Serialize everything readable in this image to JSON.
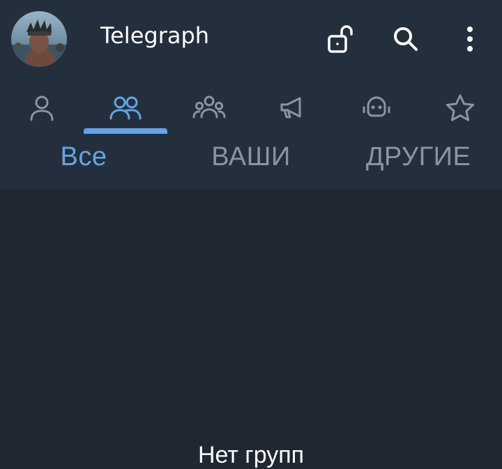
{
  "app": {
    "title": "Telegraph"
  },
  "toolbar": {
    "icons": [
      "unlocked-padlock-icon",
      "search-icon",
      "more-vertical-icon"
    ]
  },
  "categories": [
    {
      "icon": "person-icon",
      "selected": false
    },
    {
      "icon": "group-icon",
      "selected": true
    },
    {
      "icon": "community-icon",
      "selected": false
    },
    {
      "icon": "megaphone-icon",
      "selected": false
    },
    {
      "icon": "bot-icon",
      "selected": false
    },
    {
      "icon": "star-icon",
      "selected": false
    }
  ],
  "subtabs": [
    {
      "label": "Все",
      "active": true
    },
    {
      "label": "ВАШИ",
      "active": false
    },
    {
      "label": "ДРУГИЕ",
      "active": false
    }
  ],
  "content": {
    "empty_message": "Нет групп"
  },
  "colors": {
    "header_bg": "#242f3d",
    "body_bg": "#1e2732",
    "accent": "#62a5e8",
    "inactive_icon": "#8b959f",
    "text": "#ffffff"
  }
}
